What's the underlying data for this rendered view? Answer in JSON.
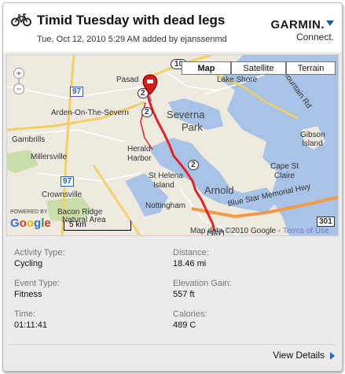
{
  "activity": {
    "title": "Timid Tuesday with dead legs",
    "meta": "Tue, Oct 12, 2010 5:29 AM added by ejanssenmd"
  },
  "logo": {
    "name": "GARMIN.",
    "sub": "Connect."
  },
  "map": {
    "type_buttons": [
      "Map",
      "Satellite",
      "Terrain"
    ],
    "active_type": "Map",
    "zoom": {
      "in": "+",
      "out": "−"
    },
    "labels": {
      "pasadena": "Pasad",
      "lake_shore": "Lake Shore",
      "mountain_rd": "Mountain Rd",
      "arden": "Arden-On-The-Severn",
      "severna": "Severna",
      "park": "Park",
      "gambrills": "Gambrills",
      "millersville": "Millersville",
      "herald": "Herald",
      "harbor": "Harbor",
      "gibson": "Gibson",
      "island": "Island",
      "cape": "Cape St",
      "claire": "Claire",
      "st_helena": "St Helena",
      "st_helena_island": "Island",
      "crownsville": "Crownsville",
      "arnold": "Arnold",
      "bacon_ridge": "Bacon Ridge",
      "natural_area": "Natural Area",
      "nottingham": "Nottingham",
      "blue_star": "Blue Star Memorial Hwy"
    },
    "shields": {
      "r10": "10",
      "r2a": "2",
      "r2b": "2",
      "r2c": "2",
      "r97a": "97",
      "r97b": "97",
      "r301": "301",
      "r50": "301"
    },
    "powered_by": "POWERED BY",
    "google": [
      "G",
      "o",
      "o",
      "g",
      "l",
      "e"
    ],
    "google_colors": [
      "#3a6fd8",
      "#d8382a",
      "#e7b50d",
      "#3a6fd8",
      "#2f9a3a",
      "#d8382a"
    ],
    "scale_label": "5 km",
    "credit": "Map data ©2010 Google - ",
    "terms": "Terms of Use"
  },
  "stats": [
    {
      "label": "Activity Type:",
      "value": "Cycling"
    },
    {
      "label": "Distance:",
      "value": "18.46 mi"
    },
    {
      "label": "Event Type:",
      "value": "Fitness"
    },
    {
      "label": "Elevation Gain:",
      "value": "557 ft"
    },
    {
      "label": "Time:",
      "value": "01:11:41"
    },
    {
      "label": "Calories:",
      "value": "489 C"
    }
  ],
  "view_details": "View Details",
  "colors": {
    "route": "#e0242a",
    "water": "#a9c3e6",
    "major_road": "#f3cf63",
    "highway": "#f09a4a",
    "land": "#efeae0",
    "park": "#c9deaa",
    "link": "#1a6fc0"
  }
}
